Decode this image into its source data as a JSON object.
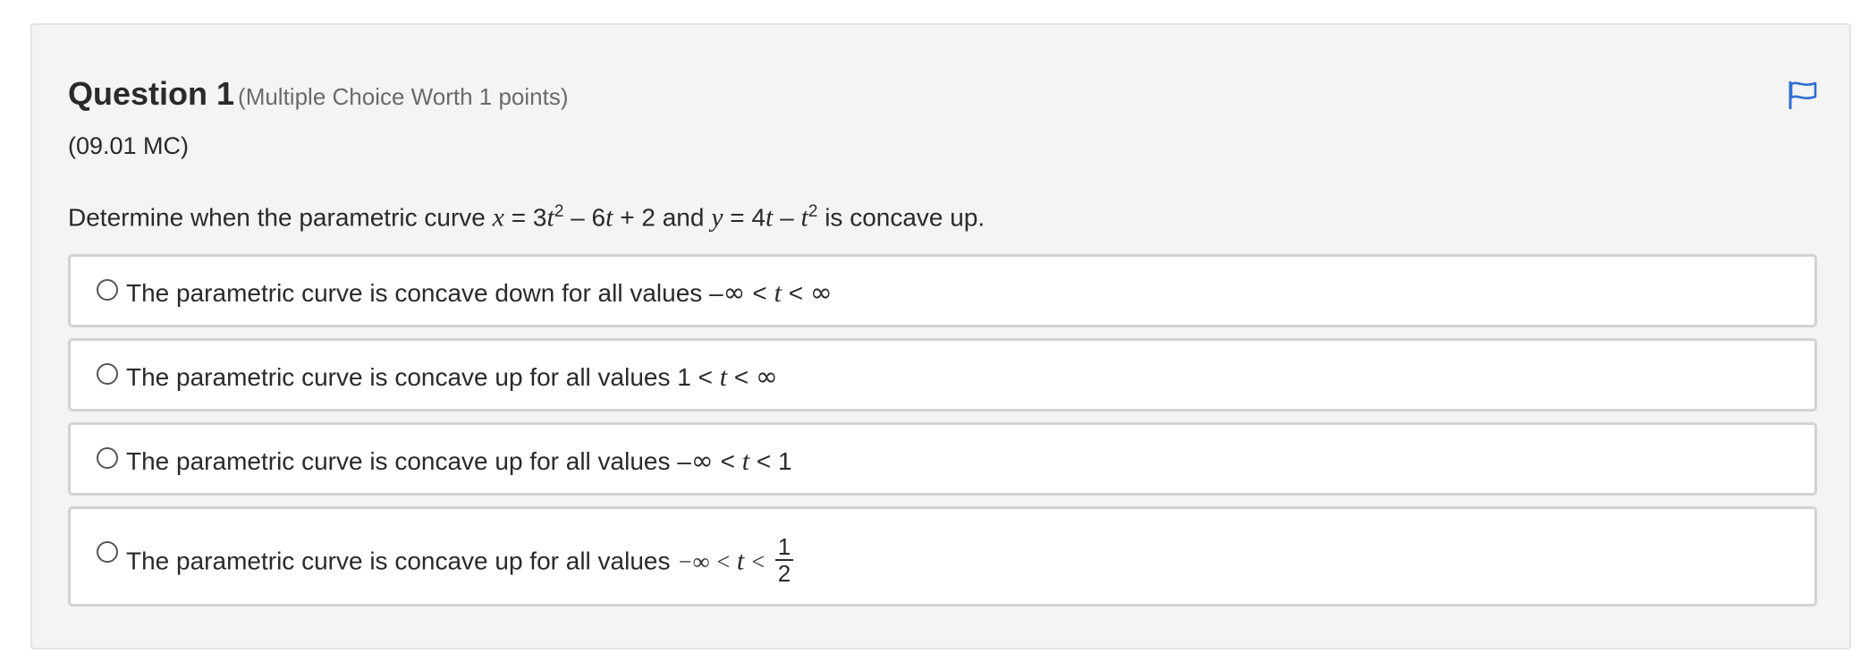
{
  "question": {
    "title": "Question 1",
    "points": "(Multiple Choice Worth 1 points)",
    "code": "(09.01 MC)",
    "prompt": {
      "lead": "Determine when the parametric curve ",
      "x_var": "x",
      "x_expr_a": " = 3",
      "t": "t",
      "sq": "2",
      "x_expr_b": " – 6",
      "x_expr_c": " + 2 and ",
      "y_var": "y",
      "y_expr_a": " = 4",
      "y_expr_b": " – ",
      "tail": " is concave up."
    },
    "flag_icon": "flag-icon",
    "accent_color": "#2f6fd1"
  },
  "options": [
    {
      "text": "The parametric curve is concave down for all values ",
      "math_a": "–",
      "inf": "∞",
      "math_b": " < ",
      "t": "t",
      "math_c": " < ",
      "inf2": "∞"
    },
    {
      "text": "The parametric curve is concave up for all values ",
      "math_a": "1 < ",
      "t": "t",
      "math_b": " < ",
      "inf": "∞"
    },
    {
      "text": "The parametric curve is concave up for all values ",
      "math_a": "–",
      "inf": "∞",
      "math_b": " < ",
      "t": "t",
      "math_c": " < 1"
    },
    {
      "text": "The parametric curve is concave up for all values ",
      "math_a": "−∞ < ",
      "t": "t",
      "math_b": " < ",
      "frac_num": "1",
      "frac_den": "2"
    }
  ]
}
